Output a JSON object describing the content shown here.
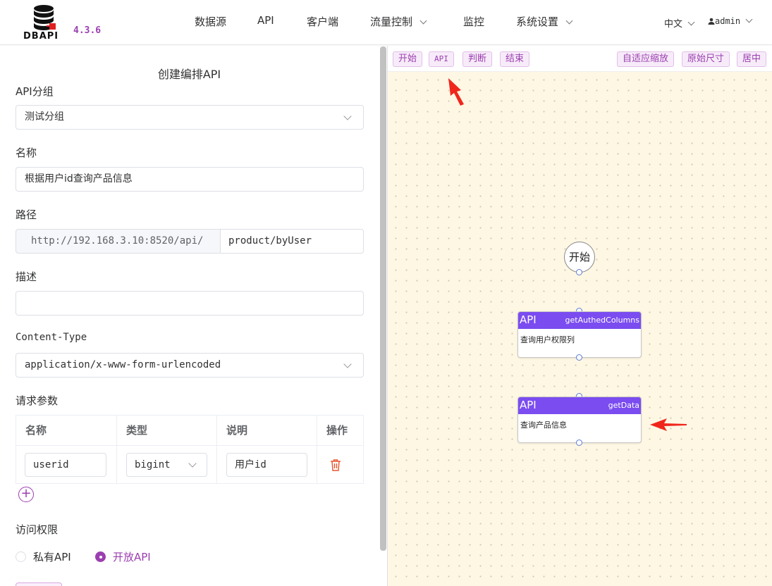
{
  "app": {
    "logo_text": "DBAPI",
    "version": "4.3.6"
  },
  "nav": {
    "items": [
      {
        "label": "数据源",
        "dropdown": false
      },
      {
        "label": "API",
        "dropdown": false
      },
      {
        "label": "客户端",
        "dropdown": false
      },
      {
        "label": "流量控制",
        "dropdown": true
      },
      {
        "label": "监控",
        "dropdown": false
      },
      {
        "label": "系统设置",
        "dropdown": true
      }
    ],
    "language": "中文",
    "user": "admin"
  },
  "form": {
    "title": "创建编排API",
    "group_label": "API分组",
    "group_value": "测试分组",
    "name_label": "名称",
    "name_value": "根据用户id查询产品信息",
    "path_label": "路径",
    "path_prefix": "http://192.168.3.10:8520/api/",
    "path_value": "product/byUser",
    "desc_label": "描述",
    "desc_value": "",
    "content_type_label": "Content-Type",
    "content_type_value": "application/x-www-form-urlencoded",
    "params_label": "请求参数",
    "params_table": {
      "headers": [
        "名称",
        "类型",
        "说明",
        "操作"
      ],
      "rows": [
        {
          "name": "userid",
          "type": "bigint",
          "desc": "用户id"
        }
      ]
    },
    "access_label": "访问权限",
    "access_options": [
      "私有API",
      "开放API"
    ],
    "access_selected": "开放API"
  },
  "toolbar": {
    "left": [
      "开始",
      "API",
      "判断",
      "结束"
    ],
    "right": [
      "自适应缩放",
      "原始尺寸",
      "居中"
    ]
  },
  "flow": {
    "start_label": "开始",
    "nodes": [
      {
        "type": "API",
        "name": "getAuthedColumns",
        "desc": "查询用户权限列"
      },
      {
        "type": "API",
        "name": "getData",
        "desc": "查询产品信息"
      }
    ]
  },
  "colors": {
    "accent": "#9b3fb0",
    "node_header": "#7b4cf0",
    "canvas_bg": "#fef7e4",
    "arrow": "#f0261c"
  }
}
